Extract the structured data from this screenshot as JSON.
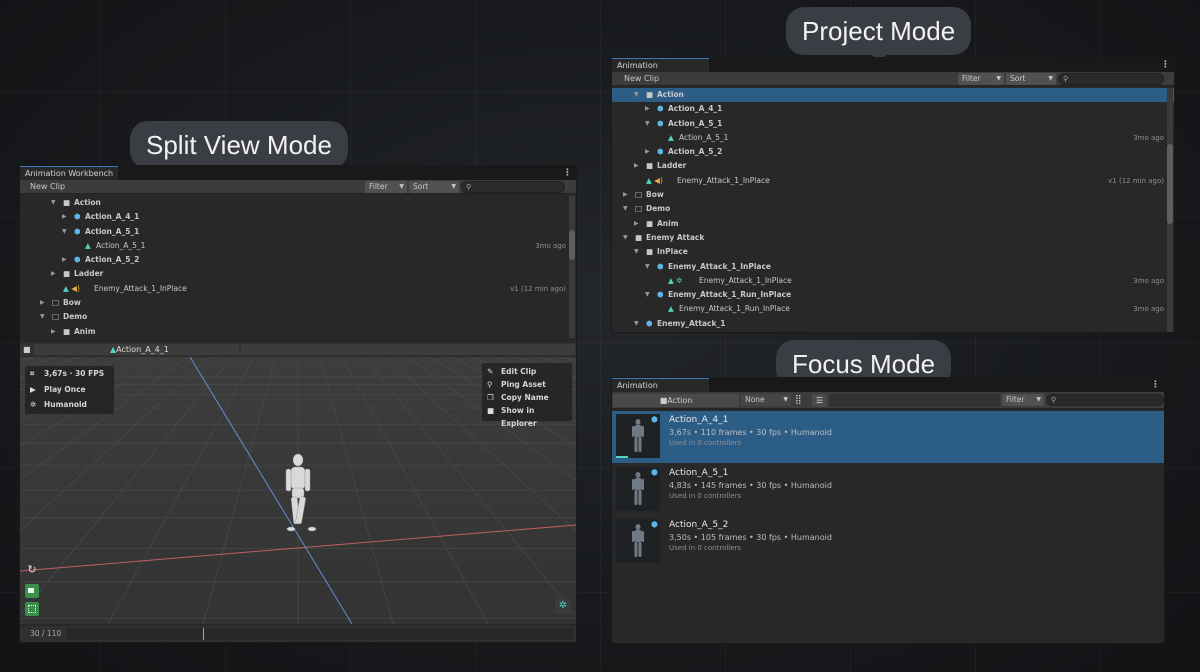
{
  "labels": {
    "split": "Split View Mode",
    "project": "Project Mode",
    "focus": "Focus Mode"
  },
  "common": {
    "window_title": "Animation Workbench",
    "new_clip": "New Clip",
    "filter": "Filter",
    "sort": "Sort",
    "menu": "⋮"
  },
  "split": {
    "tree": [
      {
        "label": "Action",
        "icon": "folder",
        "indent": 2,
        "arrow": "down",
        "bold": true
      },
      {
        "label": "Action_A_4_1",
        "icon": "cube",
        "indent": 3,
        "arrow": "right",
        "bold": true
      },
      {
        "label": "Action_A_5_1",
        "icon": "cube",
        "indent": 3,
        "arrow": "down",
        "bold": true
      },
      {
        "label": "Action_A_5_1",
        "icon": "tri",
        "indent": 4,
        "arrow": "",
        "bold": false,
        "right": "3mo ago"
      },
      {
        "label": "Action_A_5_2",
        "icon": "cube",
        "indent": 3,
        "arrow": "right",
        "bold": true
      },
      {
        "label": "Ladder",
        "icon": "folder",
        "indent": 2,
        "arrow": "right",
        "bold": true
      },
      {
        "label": "Enemy_Attack_1_InPlace",
        "icon": "trisnd",
        "indent": 2,
        "arrow": "",
        "bold": false,
        "right": "v1 (12 min ago)"
      },
      {
        "label": "Bow",
        "icon": "folder-o",
        "indent": 1,
        "arrow": "right",
        "bold": true
      },
      {
        "label": "Demo",
        "icon": "folder-o",
        "indent": 1,
        "arrow": "down",
        "bold": true
      },
      {
        "label": "Anim",
        "icon": "folder",
        "indent": 2,
        "arrow": "right",
        "bold": true
      }
    ],
    "preview_clip": "Action_A_4_1",
    "stats": {
      "duration_fps": "3,67s · 30 FPS",
      "play": "Play Once",
      "rig": "Humanoid"
    },
    "context_menu": [
      {
        "label": "Edit Clip",
        "icon": "pencil-icon",
        "glyph": "✎"
      },
      {
        "label": "Ping Asset",
        "icon": "magnifier-icon",
        "glyph": "⚲"
      },
      {
        "label": "Copy Name",
        "icon": "copy-icon",
        "glyph": "❐"
      },
      {
        "label": "Show in Explorer",
        "icon": "folder-icon",
        "glyph": "■"
      }
    ],
    "frame_counter": "30 / 110",
    "timeline_progress": 0.27
  },
  "project": {
    "tree": [
      {
        "label": "Action",
        "icon": "folder",
        "indent": 2,
        "arrow": "down",
        "bold": true,
        "sel": true
      },
      {
        "label": "Action_A_4_1",
        "icon": "cube",
        "indent": 3,
        "arrow": "right",
        "bold": true
      },
      {
        "label": "Action_A_5_1",
        "icon": "cube",
        "indent": 3,
        "arrow": "down",
        "bold": true
      },
      {
        "label": "Action_A_5_1",
        "icon": "tri",
        "indent": 4,
        "arrow": "",
        "bold": false,
        "right": "3mo ago"
      },
      {
        "label": "Action_A_5_2",
        "icon": "cube",
        "indent": 3,
        "arrow": "right",
        "bold": true
      },
      {
        "label": "Ladder",
        "icon": "folder",
        "indent": 2,
        "arrow": "right",
        "bold": true
      },
      {
        "label": "Enemy_Attack_1_InPlace",
        "icon": "trisnd",
        "indent": 2,
        "arrow": "",
        "bold": false,
        "right": "v1 (12 min ago)"
      },
      {
        "label": "Bow",
        "icon": "folder-o",
        "indent": 1,
        "arrow": "right",
        "bold": true
      },
      {
        "label": "Demo",
        "icon": "folder-o",
        "indent": 1,
        "arrow": "down",
        "bold": true
      },
      {
        "label": "Anim",
        "icon": "folder",
        "indent": 2,
        "arrow": "right",
        "bold": true
      },
      {
        "label": "Enemy Attack",
        "icon": "folder",
        "indent": 1,
        "arrow": "down",
        "bold": true
      },
      {
        "label": "InPlace",
        "icon": "folder",
        "indent": 2,
        "arrow": "down",
        "bold": true
      },
      {
        "label": "Enemy_Attack_1_InPlace",
        "icon": "cube",
        "indent": 3,
        "arrow": "down",
        "bold": true
      },
      {
        "label": "Enemy_Attack_1_InPlace",
        "icon": "trihum",
        "indent": 4,
        "arrow": "",
        "bold": false,
        "right": "3mo ago"
      },
      {
        "label": "Enemy_Attack_1_Run_InPlace",
        "icon": "cube",
        "indent": 3,
        "arrow": "down",
        "bold": true
      },
      {
        "label": "Enemy_Attack_1_Run_InPlace",
        "icon": "tri",
        "indent": 4,
        "arrow": "",
        "bold": false,
        "right": "3mo ago"
      },
      {
        "label": "Enemy_Attack_1",
        "icon": "cube",
        "indent": 2,
        "arrow": "down",
        "bold": true
      }
    ]
  },
  "focus": {
    "path": "Action",
    "none": "None",
    "clips": [
      {
        "name": "Action_A_4_1",
        "info": "3,67s • 110 frames • 30 fps • Humanoid",
        "usage": "Used in 0 controllers",
        "sel": true
      },
      {
        "name": "Action_A_5_1",
        "info": "4,83s • 145 frames • 30 fps • Humanoid",
        "usage": "Used in 0 controllers",
        "sel": false
      },
      {
        "name": "Action_A_5_2",
        "info": "3,50s • 105 frames • 30 fps • Humanoid",
        "usage": "Used in 0 controllers",
        "sel": false
      }
    ]
  }
}
